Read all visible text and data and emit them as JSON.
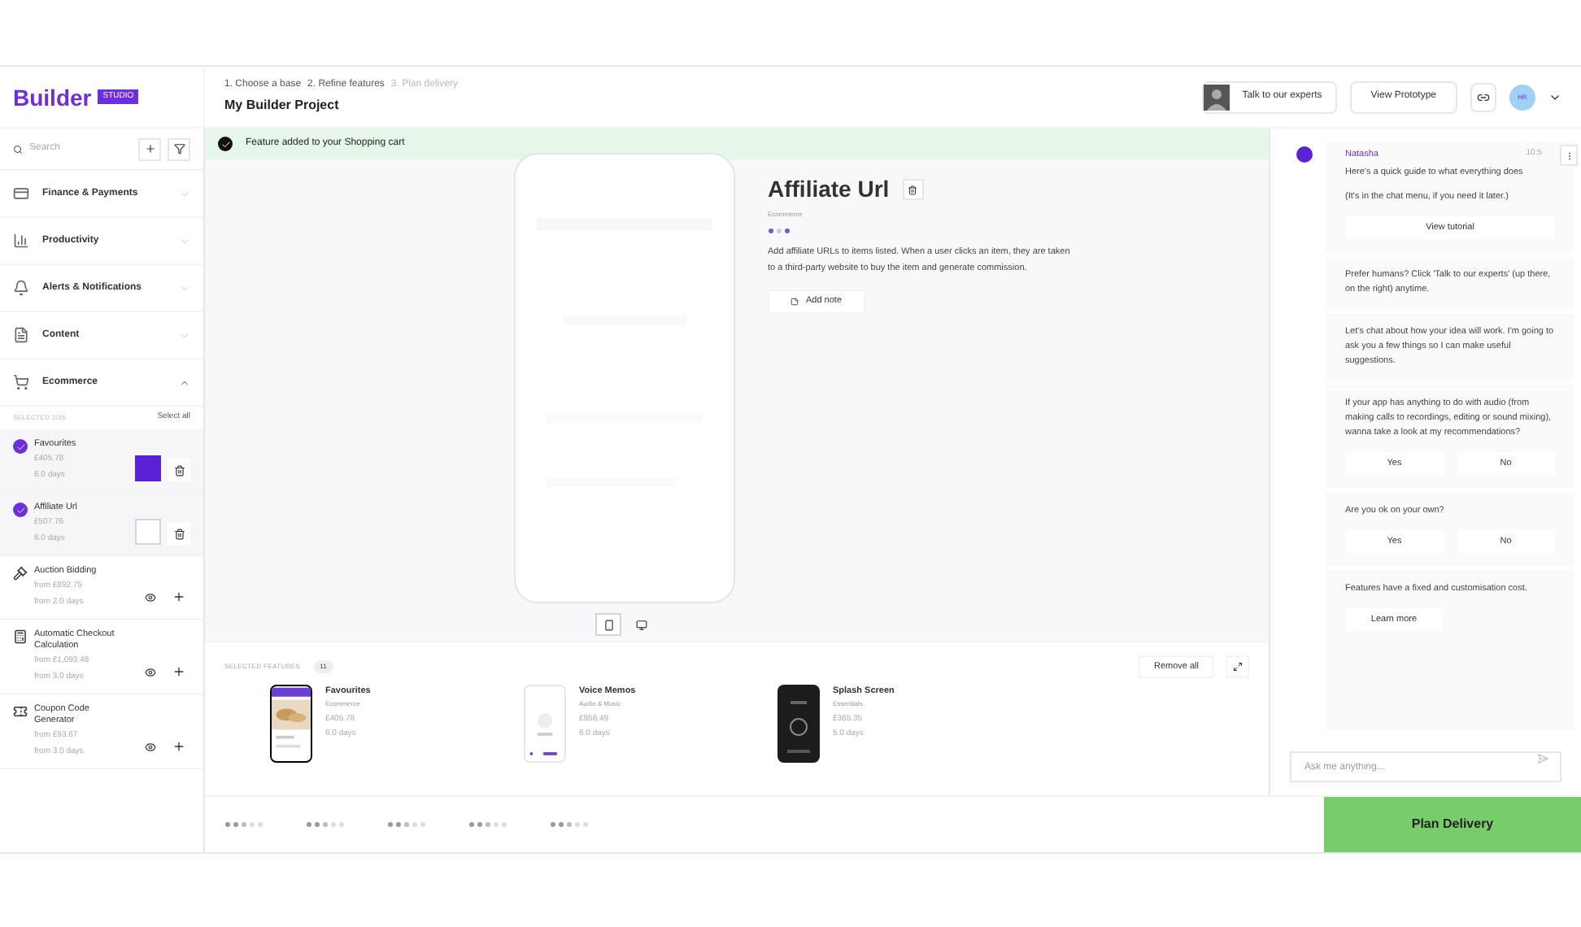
{
  "logo": {
    "word": "Builder",
    "badge": "STUDIO"
  },
  "header": {
    "steps": [
      {
        "label": "1. Choose a base",
        "done": true
      },
      {
        "label": "2. Refine features",
        "done": true
      },
      {
        "label": "3. Plan delivery",
        "done": false
      }
    ],
    "title": "My Builder Project",
    "experts_button": "Talk to our experts",
    "prototype_button": "View Prototype",
    "avatar": "HR"
  },
  "sidebar": {
    "search": {
      "placeholder": "Search"
    },
    "categories": [
      {
        "label": "Finance & Payments",
        "expanded": false
      },
      {
        "label": "Productivity",
        "expanded": false
      },
      {
        "label": "Alerts & Notifications",
        "expanded": false
      },
      {
        "label": "Content",
        "expanded": false
      },
      {
        "label": "Ecommerce",
        "expanded": true
      }
    ],
    "selected_count": "SELECTED 2/35",
    "select_all": "Select all",
    "features": [
      {
        "kind": "selected",
        "name": "Favourites",
        "price": "£405.78",
        "duration": "6.0 days",
        "highlighted": true
      },
      {
        "kind": "selected",
        "name": "Affiliate Url",
        "price": "£507.76",
        "duration": "6.0 days",
        "highlighted": false
      },
      {
        "kind": "available",
        "name": "Auction Bidding",
        "price": "from £892.75",
        "duration": "from 2.0 days"
      },
      {
        "kind": "available",
        "name": "Automatic Checkout Calculation",
        "price": "from £1,093.48",
        "duration": "from 3.0 days"
      },
      {
        "kind": "available",
        "name": "Coupon Code Generator",
        "price": "from £93.67",
        "duration": "from 3.0 days"
      }
    ]
  },
  "banner": "Feature added to your Shopping cart",
  "feature_detail": {
    "title": "Affiliate Url",
    "category": "Ecommerce",
    "description": "Add affiliate URLs to items listed. When a user clicks an item, they are taken to a third-party website to buy the item and generate commission.",
    "add_note": "Add note",
    "views": [
      {
        "kind": "mobile",
        "selected": true
      },
      {
        "kind": "desktop",
        "selected": false
      }
    ]
  },
  "selected_features": {
    "label": "SELECTED FEATURES",
    "count": "11",
    "remove_all": "Remove all",
    "items": [
      {
        "name": "Favourites",
        "category": "Ecommerce",
        "price": "£405.78",
        "duration": "6.0 days"
      },
      {
        "name": "Voice Memos",
        "category": "Audio & Music",
        "price": "£958.49",
        "duration": "6.0 days",
        "kind": "light"
      },
      {
        "name": "Splash Screen",
        "category": "Essentials",
        "price": "£365.35",
        "duration": "5.0 days",
        "kind": "dark"
      }
    ]
  },
  "chat": {
    "sender": "Natasha",
    "time": "10:5",
    "messages": [
      {
        "kind": "text",
        "text": "Here's a quick guide to what everything does"
      },
      {
        "kind": "text",
        "text": "(It's in the chat menu, if you need it later.)"
      },
      {
        "kind": "button",
        "label": "View tutorial"
      },
      {
        "kind": "divider"
      },
      {
        "kind": "text",
        "text": "Prefer humans? Click 'Talk to our experts' (up there, on the right) anytime."
      },
      {
        "kind": "divider"
      },
      {
        "kind": "text",
        "text": "Let's chat about how your idea will work. I'm going to ask you a few things so I can make useful suggestions."
      },
      {
        "kind": "divider"
      },
      {
        "kind": "text",
        "text": "If your app has anything to do with audio (from making calls to recordings, editing or sound mixing), wanna take a look at my recommendations?"
      },
      {
        "kind": "choices",
        "options": [
          "Yes",
          "No"
        ]
      },
      {
        "kind": "divider"
      },
      {
        "kind": "text",
        "text": "Are you ok on your own?"
      },
      {
        "kind": "choices",
        "options": [
          "Yes",
          "No"
        ]
      },
      {
        "kind": "divider"
      },
      {
        "kind": "text",
        "text": "Features have a fixed and customisation cost."
      },
      {
        "kind": "button",
        "label": "Learn more"
      }
    ],
    "input": {
      "placeholder": "Ask me anything..."
    }
  },
  "plan_button": "Plan Delivery"
}
